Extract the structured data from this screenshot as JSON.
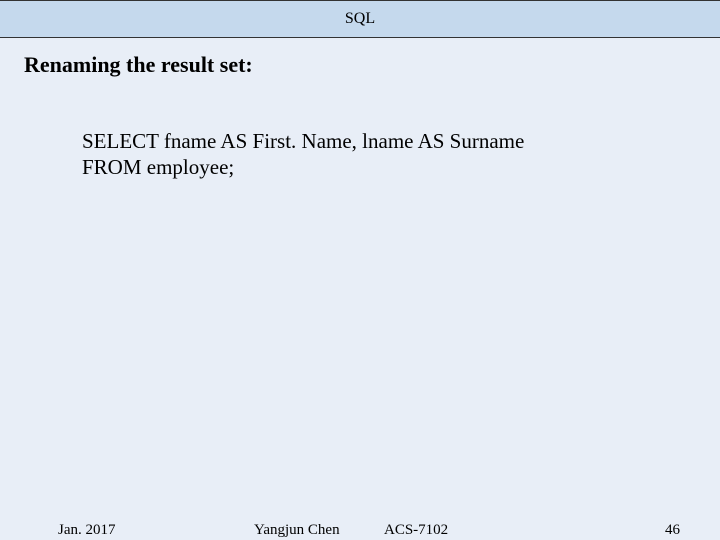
{
  "header": {
    "title": "SQL"
  },
  "subtitle": "Renaming the result set:",
  "code": {
    "line1": "SELECT fname AS First. Name, lname AS Surname",
    "line2": "FROM employee;"
  },
  "footer": {
    "date": "Jan. 2017",
    "author": "Yangjun Chen",
    "course": "ACS-7102",
    "page": "46"
  }
}
